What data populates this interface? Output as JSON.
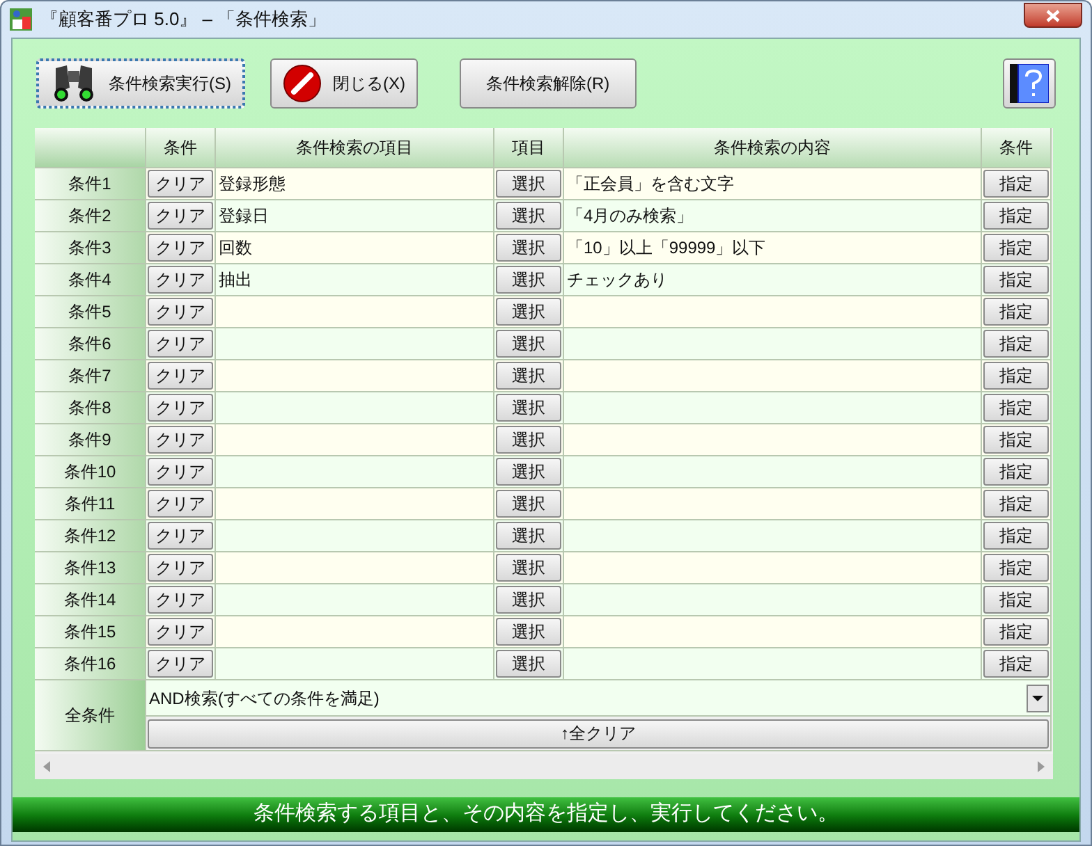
{
  "window": {
    "title": "『顧客番プロ 5.0』 – 「条件検索」"
  },
  "toolbar": {
    "buttons": [
      {
        "kind": "search",
        "label": "条件検索実行(S)",
        "focused": true
      },
      {
        "kind": "close",
        "label": "閉じる(X)",
        "focused": false
      },
      {
        "kind": "plain",
        "label": "条件検索解除(R)",
        "focused": false
      }
    ]
  },
  "table": {
    "columns": [
      "条件",
      "条件検索の項目",
      "項目",
      "条件検索の内容",
      "条件"
    ],
    "rows": [
      {
        "label": "条件1",
        "clear": "クリア",
        "item": "登録形態",
        "select": "選択",
        "content": "「正会員」を含む文字",
        "specify": "指定"
      },
      {
        "label": "条件2",
        "clear": "クリア",
        "item": "登録日",
        "select": "選択",
        "content": "「4月のみ検索」",
        "specify": "指定"
      },
      {
        "label": "条件3",
        "clear": "クリア",
        "item": "回数",
        "select": "選択",
        "content": "「10」以上「99999」以下",
        "specify": "指定"
      },
      {
        "label": "条件4",
        "clear": "クリア",
        "item": "抽出",
        "select": "選択",
        "content": "チェックあり",
        "specify": "指定"
      },
      {
        "label": "条件5",
        "clear": "クリア",
        "select": "選択",
        "specify": "指定"
      },
      {
        "label": "条件6",
        "clear": "クリア",
        "select": "選択",
        "specify": "指定"
      },
      {
        "label": "条件7",
        "clear": "クリア",
        "select": "選択",
        "specify": "指定"
      },
      {
        "label": "条件8",
        "clear": "クリア",
        "select": "選択",
        "specify": "指定"
      },
      {
        "label": "条件9",
        "clear": "クリア",
        "select": "選択",
        "specify": "指定"
      },
      {
        "label": "条件10",
        "clear": "クリア",
        "select": "選択",
        "specify": "指定"
      },
      {
        "label": "条件11",
        "clear": "クリア",
        "select": "選択",
        "specify": "指定"
      },
      {
        "label": "条件12",
        "clear": "クリア",
        "select": "選択",
        "specify": "指定"
      },
      {
        "label": "条件13",
        "clear": "クリア",
        "select": "選択",
        "specify": "指定"
      },
      {
        "label": "条件14",
        "clear": "クリア",
        "select": "選択",
        "specify": "指定"
      },
      {
        "label": "条件15",
        "clear": "クリア",
        "select": "選択",
        "specify": "指定"
      },
      {
        "label": "条件16",
        "clear": "クリア",
        "select": "選択",
        "specify": "指定"
      }
    ],
    "all_conditions": {
      "label": "全条件",
      "mode": "AND検索(すべての条件を満足)",
      "clear_all": "↑全クリア"
    }
  },
  "status_bar": "条件検索する項目と、その内容を指定し、実行してください。"
}
